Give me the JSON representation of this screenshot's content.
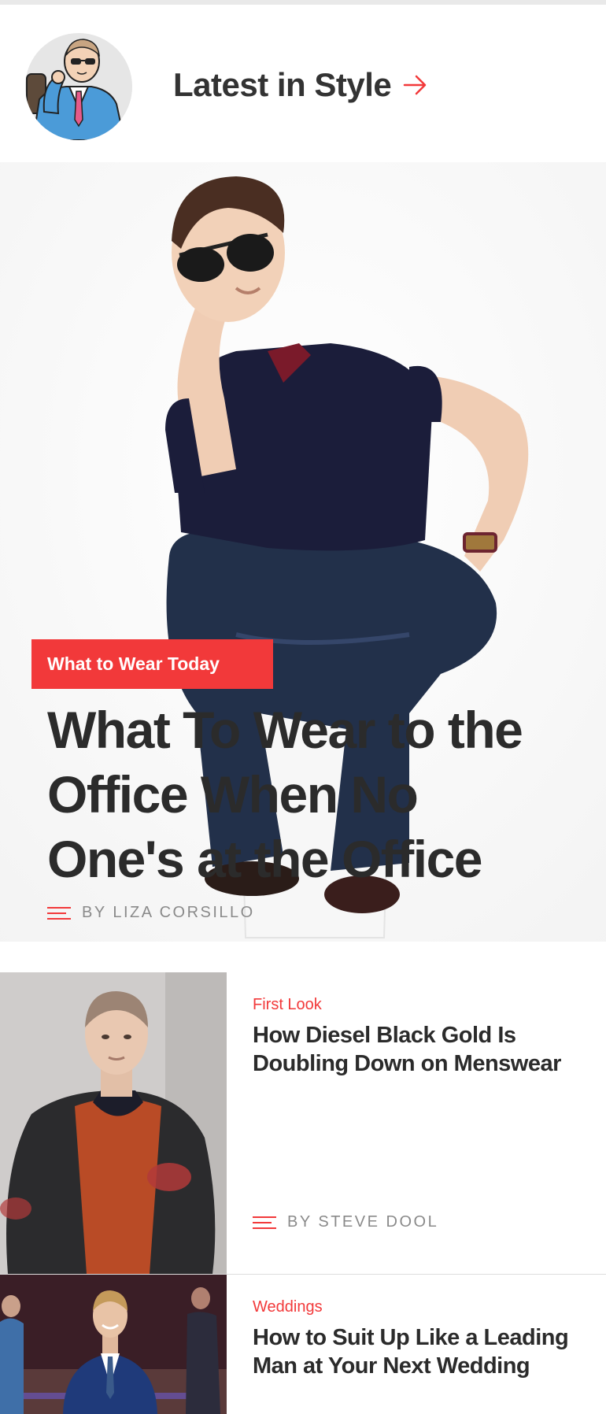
{
  "header": {
    "title": "Latest in Style",
    "avatar_icon": "illustrated-man-avatar",
    "arrow_icon": "arrow-right-icon"
  },
  "hero": {
    "badge": "What to Wear Today",
    "headline": "What To Wear to the Office When No One's at the Office",
    "byline": "BY LIZA CORSILLO"
  },
  "stories": [
    {
      "kicker": "First Look",
      "title": "How Diesel Black Gold Is Doubling Down on Menswear",
      "byline": "BY STEVE DOOL"
    },
    {
      "kicker": "Weddings",
      "title": "How to Suit Up Like a Leading Man at Your Next Wedding"
    }
  ],
  "colors": {
    "accent": "#f2393a",
    "text": "#2b2b2b",
    "byline": "#8a8a8a"
  }
}
